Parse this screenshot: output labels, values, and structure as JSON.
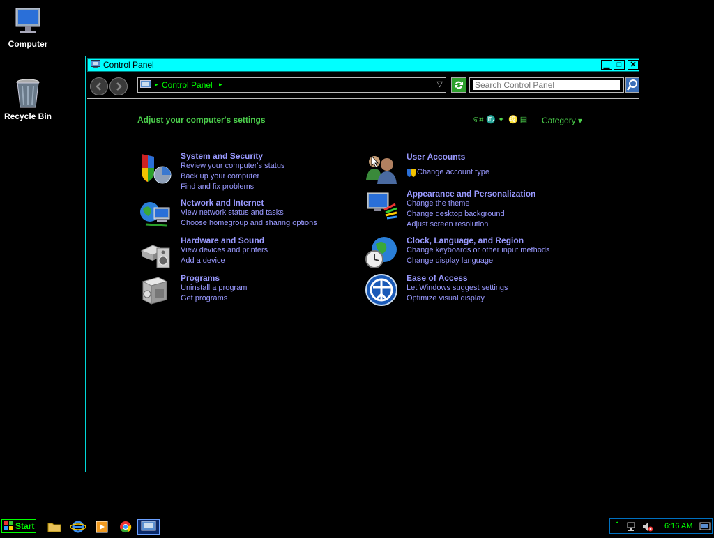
{
  "desktop": {
    "icons": [
      {
        "label": "Computer"
      },
      {
        "label": "Recycle Bin"
      }
    ]
  },
  "window": {
    "title": "Control Panel",
    "address": {
      "breadcrumb": "Control Panel"
    },
    "search": {
      "placeholder": "Search Control Panel"
    },
    "heading": "Adjust your computer's settings",
    "view_by": {
      "glyphs_1": "ବ⌘ ♏ ✦",
      "glyphs_2": "♌ ▤",
      "value": "Category"
    },
    "categories": [
      {
        "title": "System and Security",
        "links": [
          "Review your computer's status",
          "Back up your computer",
          "Find and fix problems"
        ],
        "icon": "shield-icon"
      },
      {
        "title": "Network and Internet",
        "links": [
          "View network status and tasks",
          "Choose homegroup and sharing options"
        ],
        "icon": "network-globe-icon"
      },
      {
        "title": "Hardware and Sound",
        "links": [
          "View devices and printers",
          "Add a device"
        ],
        "icon": "printer-speaker-icon"
      },
      {
        "title": "Programs",
        "links": [
          "Uninstall a program",
          "Get programs"
        ],
        "icon": "programs-box-icon"
      },
      {
        "title": "User Accounts",
        "links": [
          "Change account type"
        ],
        "icon": "users-icon"
      },
      {
        "title": "Appearance and Personalization",
        "links": [
          "Change the theme",
          "Change desktop background",
          "Adjust screen resolution"
        ],
        "icon": "monitor-palette-icon"
      },
      {
        "title": "Clock, Language, and Region",
        "links": [
          "Change keyboards or other input methods",
          "Change display language"
        ],
        "icon": "clock-globe-icon"
      },
      {
        "title": "Ease of Access",
        "links": [
          "Let Windows suggest settings",
          "Optimize visual display"
        ],
        "icon": "ease-of-access-icon"
      }
    ]
  },
  "taskbar": {
    "start_label": "Start",
    "clock": "6:16 AM"
  },
  "colors": {
    "accent": "#00ffff",
    "link": "#9999ff",
    "green": "#4cd04c"
  }
}
